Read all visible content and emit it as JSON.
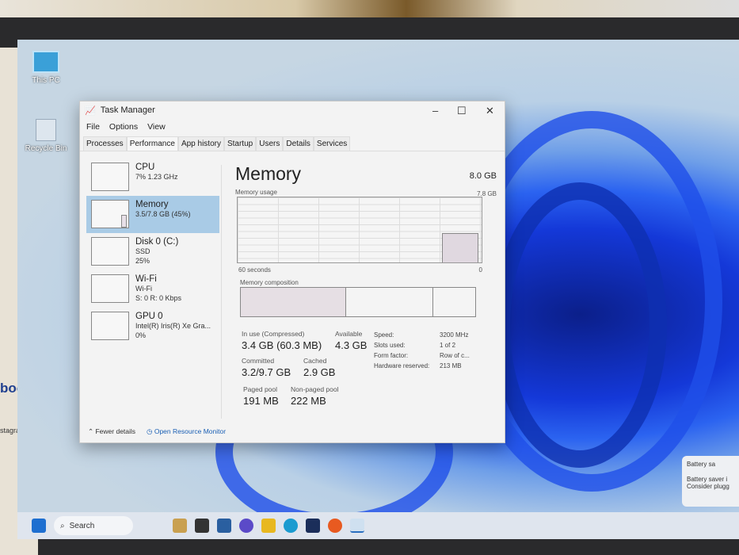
{
  "desktop": {
    "icons": [
      {
        "label": "This PC"
      },
      {
        "label": "Recycle Bin"
      }
    ],
    "stickers": [
      "book",
      "stagram"
    ]
  },
  "window": {
    "title": "Task Manager",
    "menu": [
      "File",
      "Options",
      "View"
    ],
    "tabs": [
      "Processes",
      "Performance",
      "App history",
      "Startup",
      "Users",
      "Details",
      "Services"
    ],
    "active_tab": "Performance"
  },
  "sidebar": [
    {
      "name": "CPU",
      "lines": [
        "7% 1.23 GHz"
      ]
    },
    {
      "name": "Memory",
      "lines": [
        "3.5/7.8 GB (45%)"
      ],
      "selected": true
    },
    {
      "name": "Disk 0 (C:)",
      "lines": [
        "SSD",
        "25%"
      ]
    },
    {
      "name": "Wi-Fi",
      "lines": [
        "Wi-Fi",
        "S: 0 R: 0 Kbps"
      ]
    },
    {
      "name": "GPU 0",
      "lines": [
        "Intel(R) Iris(R) Xe Gra...",
        "0%"
      ]
    }
  ],
  "memory": {
    "title": "Memory",
    "total": "8.0 GB",
    "usage_label": "Memory usage",
    "usage_max": "7.8 GB",
    "time_left": "60 seconds",
    "time_right": "0",
    "composition_label": "Memory composition",
    "usage_percent": 45,
    "in_use_label": "In use (Compressed)",
    "in_use": "3.4 GB (60.3 MB)",
    "available_label": "Available",
    "available": "4.3 GB",
    "committed_label": "Committed",
    "committed": "3.2/9.7 GB",
    "cached_label": "Cached",
    "cached": "2.9 GB",
    "paged_label": "Paged pool",
    "paged": "191 MB",
    "nonpaged_label": "Non-paged pool",
    "nonpaged": "222 MB",
    "props": [
      [
        "Speed:",
        "3200 MHz"
      ],
      [
        "Slots used:",
        "1 of 2"
      ],
      [
        "Form factor:",
        "Row of c..."
      ],
      [
        "Hardware reserved:",
        "213 MB"
      ]
    ]
  },
  "footer": {
    "fewer": "Fewer details",
    "monitor": "Open Resource Monitor"
  },
  "taskbar": {
    "search": "Search"
  },
  "toast": {
    "title": "Battery sa",
    "line1": "Battery saver i",
    "line2": "Consider plugg"
  }
}
